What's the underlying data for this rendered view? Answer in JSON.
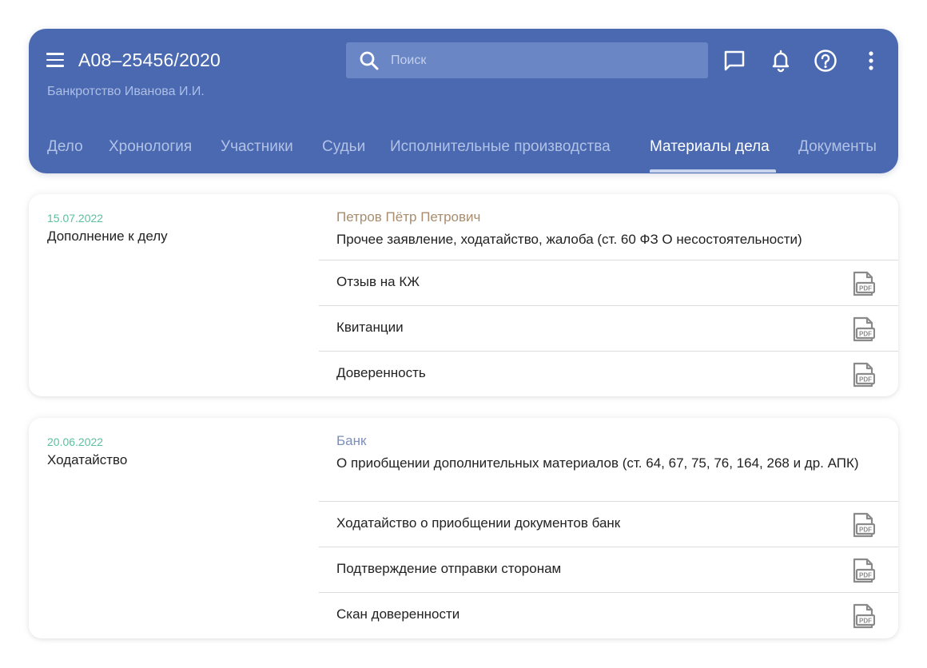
{
  "header": {
    "case_number": "А08–25456/2020",
    "case_subtitle": "Банкротство Иванова И.И.",
    "search_placeholder": "Поиск",
    "colors": {
      "background": "#4a69b0",
      "search_bg": "#6a86c4"
    },
    "icons": [
      "menu-icon",
      "search-icon",
      "chat-icon",
      "bell-icon",
      "help-icon",
      "more-vert-icon"
    ]
  },
  "tabs": [
    {
      "label": "Дело"
    },
    {
      "label": "Хронология"
    },
    {
      "label": "Участники"
    },
    {
      "label": "Судьи"
    },
    {
      "label": "Исполнительные производства"
    },
    {
      "label": "Материалы дела",
      "active": true
    },
    {
      "label": "Документы"
    }
  ],
  "entries": [
    {
      "date": "15.07.2022",
      "type": "Дополнение к делу",
      "author": "Петров Пётр Петрович",
      "author_color": "#a88d6e",
      "description": "Прочее заявление, ходатайство, жалоба (ст. 60 ФЗ О несостоятельности)",
      "documents": [
        {
          "name": "Отзыв на КЖ",
          "icon": "pdf-file-icon"
        },
        {
          "name": "Квитанции",
          "icon": "pdf-file-icon"
        },
        {
          "name": "Доверенность",
          "icon": "pdf-file-icon"
        }
      ]
    },
    {
      "date": "20.06.2022",
      "type": "Ходатайство",
      "author": "Банк",
      "author_color": "#7a8fbf",
      "description": "О приобщении дополнительных материалов (ст. 64, 67, 75, 76, 164, 268 и др. АПК)",
      "documents": [
        {
          "name": "Ходатайство о приобщении документов банк",
          "icon": "pdf-file-icon"
        },
        {
          "name": "Подтверждение отправки сторонам",
          "icon": "pdf-file-icon"
        },
        {
          "name": "Скан доверенности",
          "icon": "pdf-file-icon"
        }
      ]
    }
  ],
  "colors": {
    "date": "#5bc0a0",
    "pdf_icon": "#8a8a8a"
  }
}
